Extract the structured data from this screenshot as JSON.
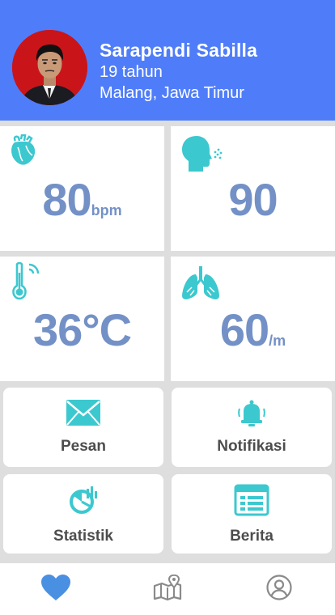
{
  "profile": {
    "name": "Sarapendi Sabilla",
    "age": "19 tahun",
    "location": "Malang, Jawa Timur"
  },
  "vitals": [
    {
      "icon": "heart-organ-icon",
      "value": "80",
      "unit": "bpm"
    },
    {
      "icon": "breathing-head-icon",
      "value": "90",
      "unit": ""
    },
    {
      "icon": "thermometer-icon",
      "value": "36°C",
      "unit": ""
    },
    {
      "icon": "lungs-icon",
      "value": "60",
      "unit": "/m"
    }
  ],
  "menu": [
    {
      "icon": "envelope-icon",
      "label": "Pesan"
    },
    {
      "icon": "bell-icon",
      "label": "Notifikasi"
    },
    {
      "icon": "pie-chart-icon",
      "label": "Statistik"
    },
    {
      "icon": "news-icon",
      "label": "Berita"
    }
  ],
  "nav": [
    {
      "icon": "heart-icon",
      "active": true
    },
    {
      "icon": "map-pin-icon",
      "active": false
    },
    {
      "icon": "user-circle-icon",
      "active": false
    }
  ],
  "colors": {
    "header": "#4f7df9",
    "accent": "#3cc8cf",
    "value": "#7391c6",
    "nav_active": "#4a90e2",
    "nav_inactive": "#8a8a8a"
  }
}
